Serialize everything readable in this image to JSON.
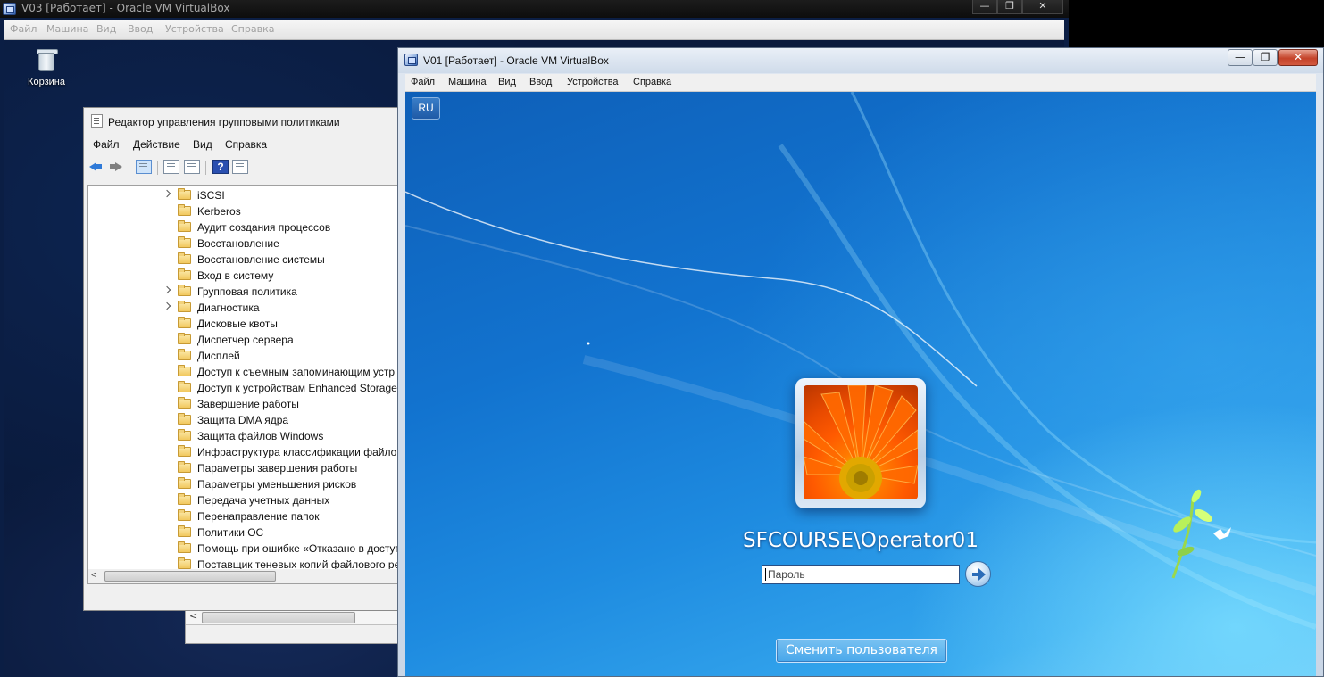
{
  "back_window": {
    "title": "V03 [Работает] - Oracle VM VirtualBox",
    "controls": {
      "minimize": "—",
      "maximize": "❐",
      "close": "✕"
    },
    "menu": [
      "Файл",
      "Машина",
      "Вид",
      "Ввод",
      "Устройства",
      "Справка"
    ],
    "desktop": {
      "recycle_bin_label": "Корзина"
    },
    "gpo_editor": {
      "title": "Редактор управления групповыми политиками",
      "menu": [
        "Файл",
        "Действие",
        "Вид",
        "Справка"
      ],
      "toolbar": {
        "help": "?"
      },
      "tree_items": [
        {
          "label": "iSCSI",
          "expandable": true
        },
        {
          "label": "Kerberos",
          "expandable": false
        },
        {
          "label": "Аудит создания процессов",
          "expandable": false
        },
        {
          "label": "Восстановление",
          "expandable": false
        },
        {
          "label": "Восстановление системы",
          "expandable": false
        },
        {
          "label": "Вход в систему",
          "expandable": false
        },
        {
          "label": "Групповая политика",
          "expandable": true
        },
        {
          "label": "Диагностика",
          "expandable": true
        },
        {
          "label": "Дисковые квоты",
          "expandable": false
        },
        {
          "label": "Диспетчер сервера",
          "expandable": false
        },
        {
          "label": "Дисплей",
          "expandable": false
        },
        {
          "label": "Доступ к съемным запоминающим устр",
          "expandable": false
        },
        {
          "label": "Доступ к устройствам Enhanced Storage",
          "expandable": false
        },
        {
          "label": "Завершение работы",
          "expandable": false
        },
        {
          "label": "Защита DMA ядра",
          "expandable": false
        },
        {
          "label": "Защита файлов Windows",
          "expandable": false
        },
        {
          "label": "Инфраструктура классификации файлов",
          "expandable": false
        },
        {
          "label": "Параметры завершения работы",
          "expandable": false
        },
        {
          "label": "Параметры уменьшения рисков",
          "expandable": false
        },
        {
          "label": "Передача учетных данных",
          "expandable": false
        },
        {
          "label": "Перенаправление папок",
          "expandable": false
        },
        {
          "label": "Политики ОС",
          "expandable": false
        },
        {
          "label": "Помощь при ошибке «Отказано в доступ",
          "expandable": false
        },
        {
          "label": "Поставщик теневых копий файлового ре",
          "expandable": false
        }
      ],
      "scroll_left": "<"
    }
  },
  "front_window": {
    "title": "V01 [Работает] - Oracle VM VirtualBox",
    "controls": {
      "minimize": "—",
      "maximize": "❐",
      "close": "✕"
    },
    "menu": [
      "Файл",
      "Машина",
      "Вид",
      "Ввод",
      "Устройства",
      "Справка"
    ],
    "logon": {
      "language": "RU",
      "username": "SFCOURSE\\Operator01",
      "password_placeholder": "Пароль",
      "switch_user": "Сменить пользователя"
    }
  },
  "colors": {
    "win7_blue": "#1273cf",
    "bvox_dark_titlebar": "#0d0d0d"
  }
}
